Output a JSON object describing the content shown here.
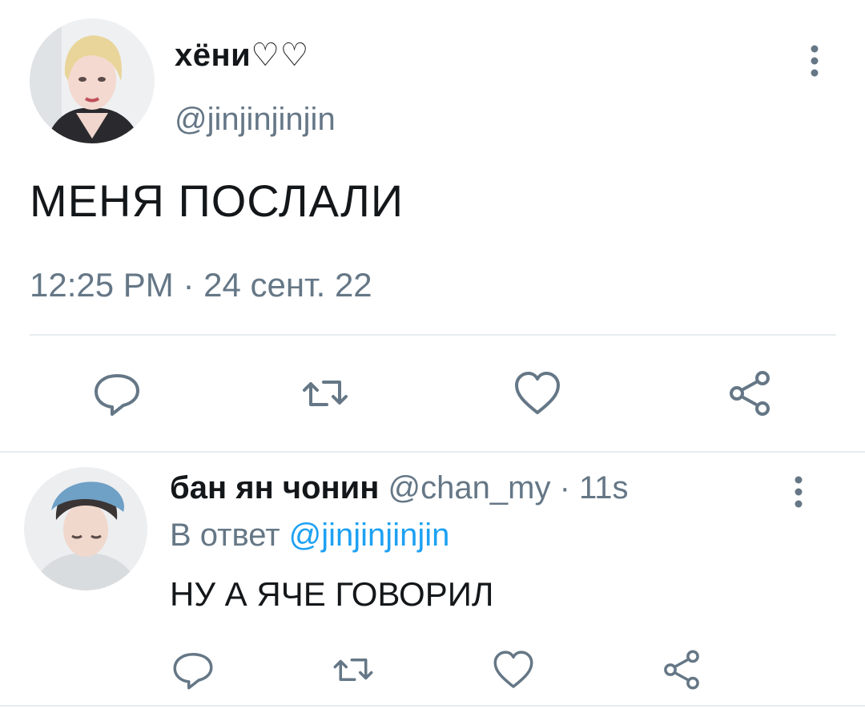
{
  "main_tweet": {
    "display_name": "хёни♡♡",
    "handle": "@jinjinjinjin",
    "text": "МЕНЯ ПОСЛАЛИ",
    "timestamp": "12:25 PM · 24 сент. 22",
    "avatar_icon": "profile-photo",
    "more_icon": "more-vertical-icon",
    "actions": [
      "reply-icon",
      "retweet-icon",
      "like-icon",
      "share-icon"
    ]
  },
  "reply_tweet": {
    "display_name": "бан ян чонин",
    "handle": "@chan_my",
    "separator": " · ",
    "time": "11s",
    "reply_prefix": "В ответ",
    "reply_to": "@jinjinjinjin",
    "text": "НУ А ЯЧЕ ГОВОРИЛ",
    "avatar_icon": "profile-photo",
    "more_icon": "more-vertical-icon",
    "actions": [
      "reply-icon",
      "retweet-icon",
      "like-icon",
      "share-icon"
    ]
  },
  "colors": {
    "text": "#14171a",
    "secondary": "#657786",
    "link": "#1da1f2",
    "divider": "#e6ecf0",
    "icon": "#657786"
  }
}
